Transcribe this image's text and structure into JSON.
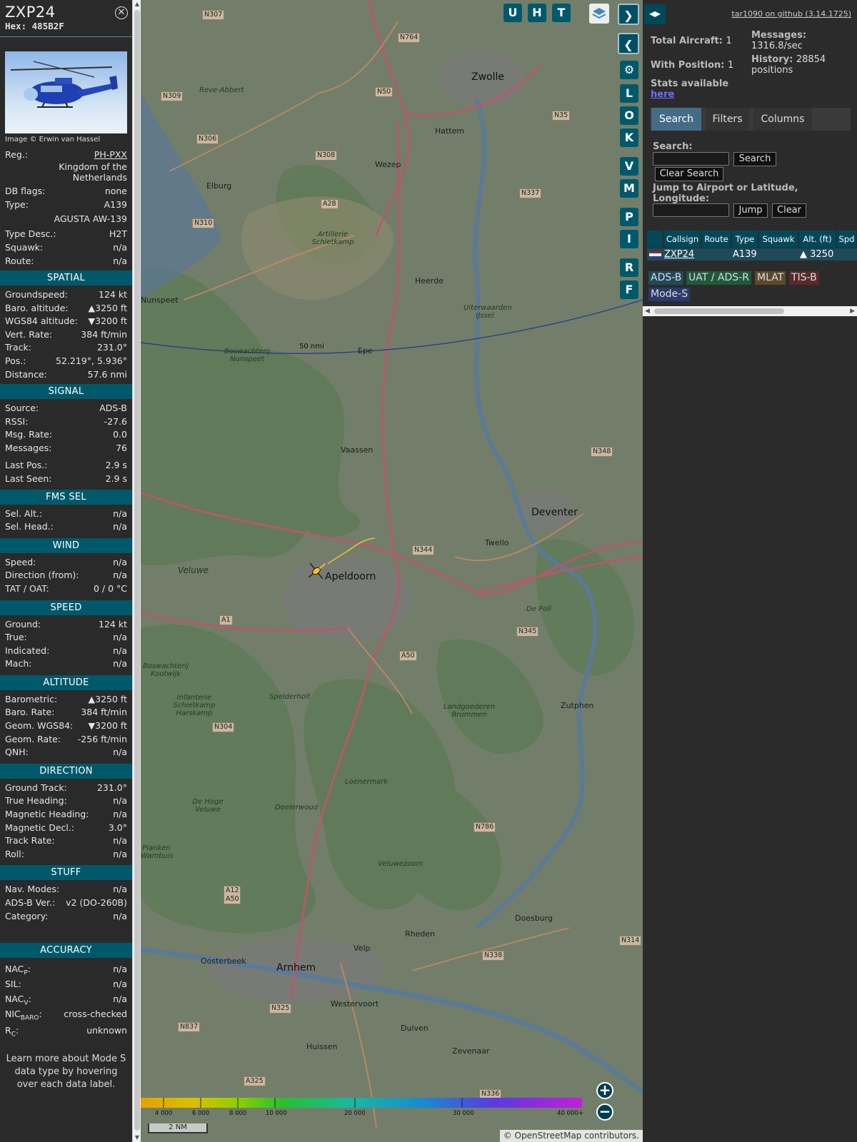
{
  "info": {
    "callsign": "ZXP24",
    "hex_label": "Hex:",
    "hex": "485B2F",
    "image_credit": "Image © Erwin van Hassel",
    "reg": {
      "k": "Reg.:",
      "v": "PH-PXX"
    },
    "country": "Kingdom of the Netherlands",
    "db_flags": {
      "k": "DB flags:",
      "v": "none"
    },
    "type": {
      "k": "Type:",
      "v": "A139"
    },
    "type_full": "AGUSTA AW-139",
    "type_desc": {
      "k": "Type Desc.:",
      "v": "H2T"
    },
    "squawk": {
      "k": "Squawk:",
      "v": "n/a"
    },
    "route": {
      "k": "Route:",
      "v": "n/a"
    },
    "spatial": {
      "title": "SPATIAL",
      "rows": [
        {
          "k": "Groundspeed:",
          "v": "124 kt"
        },
        {
          "k": "Baro. altitude:",
          "v": "▲3250 ft"
        },
        {
          "k": "WGS84 altitude:",
          "v": "▼3200 ft"
        },
        {
          "k": "Vert. Rate:",
          "v": "384 ft/min"
        },
        {
          "k": "Track:",
          "v": "231.0°"
        },
        {
          "k": "Pos.:",
          "v": "52.219°, 5.936°"
        },
        {
          "k": "Distance:",
          "v": "57.6 nmi"
        }
      ]
    },
    "signal": {
      "title": "SIGNAL",
      "rows": [
        {
          "k": "Source:",
          "v": "ADS-B"
        },
        {
          "k": "RSSI:",
          "v": "-27.6"
        },
        {
          "k": "Msg. Rate:",
          "v": "0.0"
        },
        {
          "k": "Messages:",
          "v": "76"
        }
      ],
      "rows2": [
        {
          "k": "Last Pos.:",
          "v": "2.9 s"
        },
        {
          "k": "Last Seen:",
          "v": "2.9 s"
        }
      ]
    },
    "fms": {
      "title": "FMS SEL",
      "rows": [
        {
          "k": "Sel. Alt.:",
          "v": "n/a"
        },
        {
          "k": "Sel. Head.:",
          "v": "n/a"
        }
      ]
    },
    "wind": {
      "title": "WIND",
      "rows": [
        {
          "k": "Speed:",
          "v": "n/a"
        },
        {
          "k": "Direction (from):",
          "v": "n/a"
        },
        {
          "k": "TAT / OAT:",
          "v": "0 / 0 °C"
        }
      ]
    },
    "speed": {
      "title": "SPEED",
      "rows": [
        {
          "k": "Ground:",
          "v": "124 kt"
        },
        {
          "k": "True:",
          "v": "n/a"
        },
        {
          "k": "Indicated:",
          "v": "n/a"
        },
        {
          "k": "Mach:",
          "v": "n/a"
        }
      ]
    },
    "altitude": {
      "title": "ALTITUDE",
      "rows": [
        {
          "k": "Barometric:",
          "v": "▲3250 ft"
        },
        {
          "k": "Baro. Rate:",
          "v": "384 ft/min"
        },
        {
          "k": "Geom. WGS84:",
          "v": "▼3200 ft"
        },
        {
          "k": "Geom. Rate:",
          "v": "-256 ft/min"
        },
        {
          "k": "QNH:",
          "v": "n/a"
        }
      ]
    },
    "direction": {
      "title": "DIRECTION",
      "rows": [
        {
          "k": "Ground Track:",
          "v": "231.0°"
        },
        {
          "k": "True Heading:",
          "v": "n/a"
        },
        {
          "k": "Magnetic Heading:",
          "v": "n/a"
        },
        {
          "k": "Magnetic Decl.:",
          "v": "3.0°"
        },
        {
          "k": "Track Rate:",
          "v": "n/a"
        },
        {
          "k": "Roll:",
          "v": "n/a"
        }
      ]
    },
    "stuff": {
      "title": "STUFF",
      "rows": [
        {
          "k": "Nav. Modes:",
          "v": "n/a"
        },
        {
          "k": "ADS-B Ver.:",
          "v": "v2 (DO-260B)"
        },
        {
          "k": "Category:",
          "v": "n/a"
        }
      ]
    },
    "accuracy": {
      "title": "ACCURACY",
      "nacp": {
        "k1": "NAC",
        "sub": "P",
        "k2": ":",
        "v": "n/a"
      },
      "sil": {
        "k": "SIL:",
        "v": "n/a"
      },
      "nacv": {
        "k1": "NAC",
        "sub": "V",
        "k2": ":",
        "v": "n/a"
      },
      "nicbaro": {
        "k1": "NIC",
        "sub": "BARO",
        "k2": ":",
        "v": "cross-checked"
      },
      "rc": {
        "k1": "R",
        "sub": "C",
        "k2": ":",
        "v": "unknown"
      }
    },
    "note": "Learn more about Mode S data type by hovering over each data label."
  },
  "map": {
    "cities": [
      {
        "n": "Zwolle"
      },
      {
        "n": "Deventer"
      },
      {
        "n": "Apeldoorn"
      },
      {
        "n": "Arnhem"
      }
    ],
    "towns": [
      "Hattem",
      "Wezep",
      "Elburg",
      "Heerde",
      "Epe",
      "Nunspeet",
      "Vaassen",
      "Twello",
      "Zutphen",
      "Doesburg",
      "Rheden",
      "Velp",
      "Oosterbeek",
      "Westervoort",
      "Duiven",
      "Huissen",
      "Zevenaar",
      "Reve-Abbert"
    ],
    "nature": [
      "Artillerie Schietkamp",
      "Uiterwaarden IJssel",
      "Boswachterij Nunspeet",
      "Veluwe",
      "De Poll",
      "Boswachterij Kootwijk",
      "Spelderholt",
      "Infanterie Schietkamp Harskamp",
      "Landgoederen Brummen",
      "Loenermark",
      "De Hoge Veluwe",
      "Deelerwoud",
      "Veluwezoom",
      "Planken Wambuis"
    ],
    "roads": [
      "N307",
      "N764",
      "N309",
      "N50",
      "N35",
      "N306",
      "N308",
      "N337",
      "A28",
      "N310",
      "N344",
      "A1",
      "A50",
      "N345",
      "N348",
      "N304",
      "N786",
      "A12 A50",
      "N338",
      "N325",
      "N837",
      "A325",
      "N336",
      "N314"
    ],
    "range_label": "50 nmi",
    "buttons_top": [
      "U",
      "H",
      "T"
    ],
    "buttons_side": [
      "L",
      "O",
      "K",
      "V",
      "M",
      "P",
      "I",
      "R",
      "F"
    ],
    "colorbar_ticks": [
      "4 000",
      "6 000",
      "8 000",
      "10 000",
      "20 000",
      "30 000",
      "40 000+"
    ],
    "scale": "2 NM",
    "attribution": "© OpenStreetMap contributors."
  },
  "side": {
    "github": "tar1090 on github (3.14.1725)",
    "total_aircraft_k": "Total Aircraft:",
    "total_aircraft_v": "1",
    "messages_k": "Messages:",
    "messages_v": "1316.8/sec",
    "with_pos_k": "With Position:",
    "with_pos_v": "1",
    "history_k": "History:",
    "history_v": "28854",
    "history_unit": "positions",
    "stats_text": "Stats available",
    "stats_link": "here",
    "tabs": [
      "Search",
      "Filters",
      "Columns"
    ],
    "search_label": "Search:",
    "search_button": "Search",
    "clear_search_button": "Clear Search",
    "jump_label": "Jump to Airport or Latitude, Longitude:",
    "jump_button": "Jump",
    "clear_button": "Clear",
    "columns": [
      "Callsign",
      "Route",
      "Type",
      "Squawk",
      "Alt. (ft)",
      "Spd"
    ],
    "row": {
      "callsign": "ZXP24",
      "type": "A139",
      "alt": "▲ 3250"
    },
    "legend": [
      "ADS-B",
      "UAT / ADS-R",
      "MLAT",
      "TIS-B",
      "Mode-S"
    ],
    "legend_colors": [
      "#1e4a5a",
      "#1e5a3a",
      "#5c4a2a",
      "#5a2a2a",
      "#2a3a6a"
    ]
  }
}
